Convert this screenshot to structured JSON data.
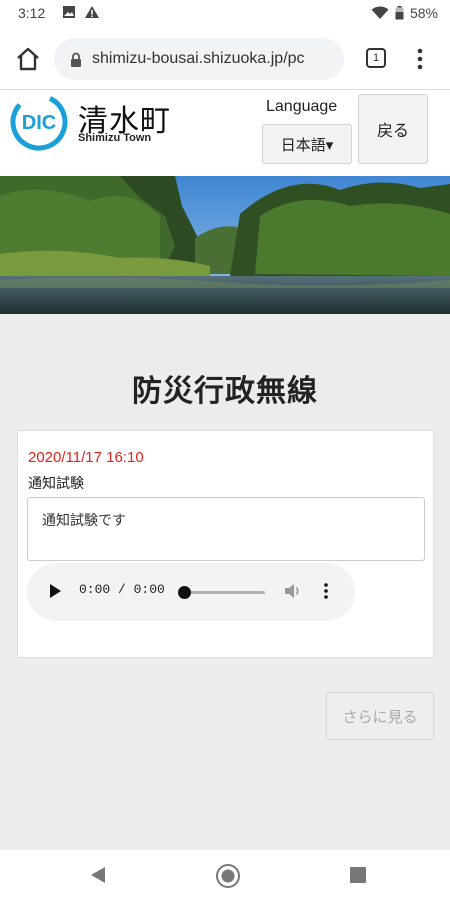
{
  "status_bar": {
    "time": "3:12",
    "battery": "58%",
    "icons": [
      "image-icon",
      "warning-icon",
      "wifi-icon",
      "battery-icon"
    ]
  },
  "browser": {
    "url": "shimizu-bousai.shizuoka.jp/pc",
    "tab_count": "1"
  },
  "header": {
    "logo_kanji": "清水町",
    "logo_roman": "Shimizu Town",
    "language_label": "Language",
    "language_selected": "日本語▾",
    "back_label": "戻る"
  },
  "main": {
    "title": "防災行政無線",
    "notice": {
      "datetime": "2020/11/17 16:10",
      "subject": "通知試験",
      "message": "通知試験です",
      "audio_time": "0:00 / 0:00"
    },
    "more_label": "さらに見る"
  },
  "colors": {
    "accent_red": "#e4201c",
    "logo_blue": "#1aa0d8"
  }
}
